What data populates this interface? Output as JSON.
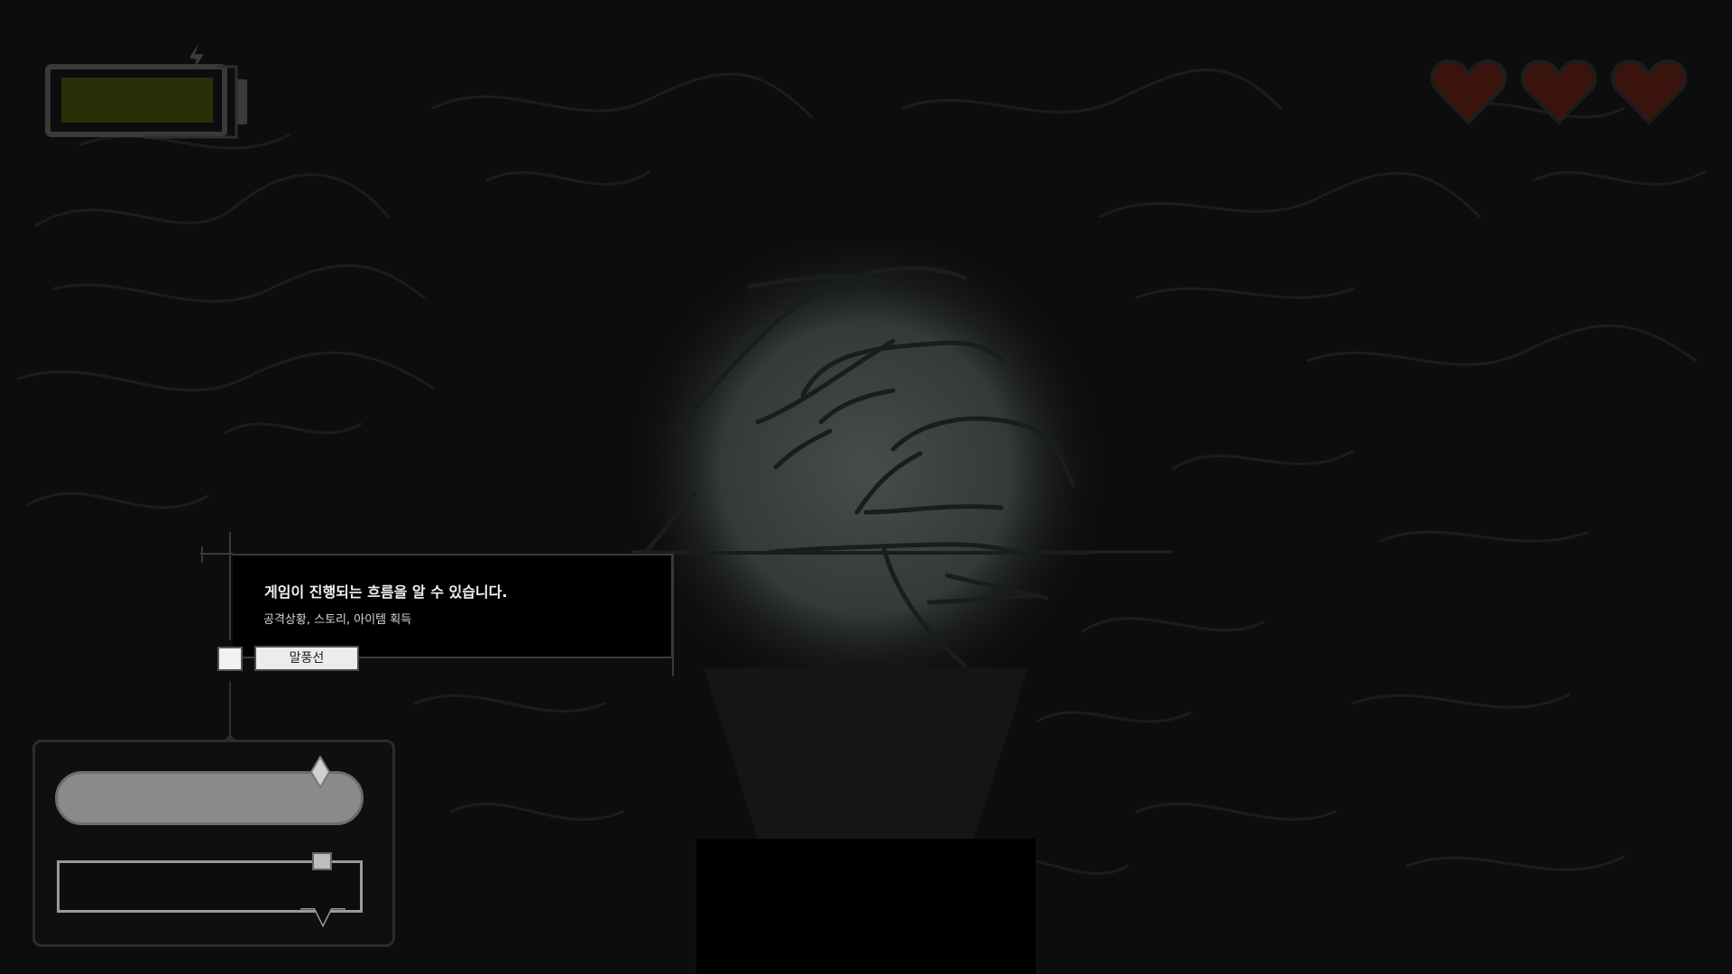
{
  "hud": {
    "battery": {
      "label": "battery-indicator",
      "level": 0.85,
      "fill_color": "#2a2f08",
      "icon": "lightning-icon"
    },
    "lives": {
      "current": 3,
      "max": 3,
      "icon": "heart-icon",
      "color": "#3a140c"
    }
  },
  "tutorial": {
    "title": "게임이 진행되는 흐름을 알 수 있습니다.",
    "subtitle": "공격상황, 스토리, 아이템 획득",
    "tag_label": "말풍선"
  },
  "panel": {
    "slider_level": 0.86,
    "text_field_value": ""
  },
  "colors": {
    "background": "#0d0d0d",
    "orb": "#3c4242",
    "line_art": "#1a1a1a"
  }
}
